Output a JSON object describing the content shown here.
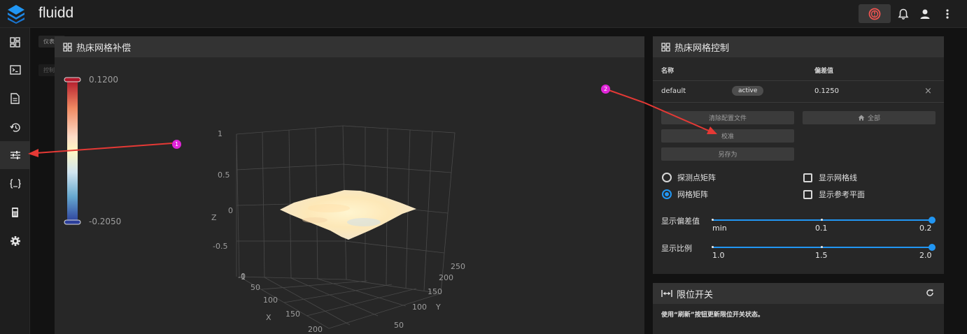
{
  "app": {
    "title": "fluidd"
  },
  "topbar": {
    "icons": [
      "emergency-stop-icon",
      "bell-icon",
      "account-icon",
      "more-vertical-icon"
    ]
  },
  "sidebar": {
    "items": [
      "dashboard-icon",
      "console-icon",
      "file-icon",
      "history-icon",
      "tune-icon",
      "macros-icon",
      "device-icon",
      "settings-icon"
    ],
    "tooltips": [
      "仪表板",
      "控制台"
    ]
  },
  "mesh_card": {
    "title": "热床网格补偿",
    "scale": {
      "max": "0.1200",
      "min": "-0.2050"
    },
    "axes": {
      "z_label": "Z",
      "x_label": "X",
      "y_label": "Y",
      "z_ticks": [
        "1",
        "0.5",
        "0",
        "-0.5",
        "-1"
      ],
      "x_ticks": [
        "0",
        "50",
        "100",
        "150",
        "200"
      ],
      "y_ticks": [
        "250",
        "200",
        "150",
        "100",
        "50"
      ]
    }
  },
  "control_card": {
    "title": "热床网格控制",
    "columns": {
      "name": "名称",
      "variance": "偏差值"
    },
    "row": {
      "name": "default",
      "status": "active",
      "variance": "0.1250",
      "action": "×"
    },
    "buttons": {
      "clear": "清除配置文件",
      "home": "全部",
      "calibrate": "校准",
      "save_as": "另存为"
    },
    "options": {
      "probed": "探测点矩阵",
      "mesh": "网格矩阵",
      "wireframe": "显示网格线",
      "flat": "显示参考平面"
    },
    "slider_variance": {
      "label": "显示偏差值",
      "ticks": [
        "min",
        "0.1",
        "0.2"
      ],
      "value": 1.0
    },
    "slider_scale": {
      "label": "显示比例",
      "ticks": [
        "1.0",
        "1.5",
        "2.0"
      ],
      "value": 1.0
    }
  },
  "endstop_card": {
    "title": "限位开关",
    "message": "使用“刷新”按钮更新限位开关状态。"
  },
  "annotations": {
    "first": "1",
    "second": "2"
  },
  "colors": {
    "accent": "#2196f3",
    "annotation": "#e024d8",
    "arrow": "#e53935"
  }
}
